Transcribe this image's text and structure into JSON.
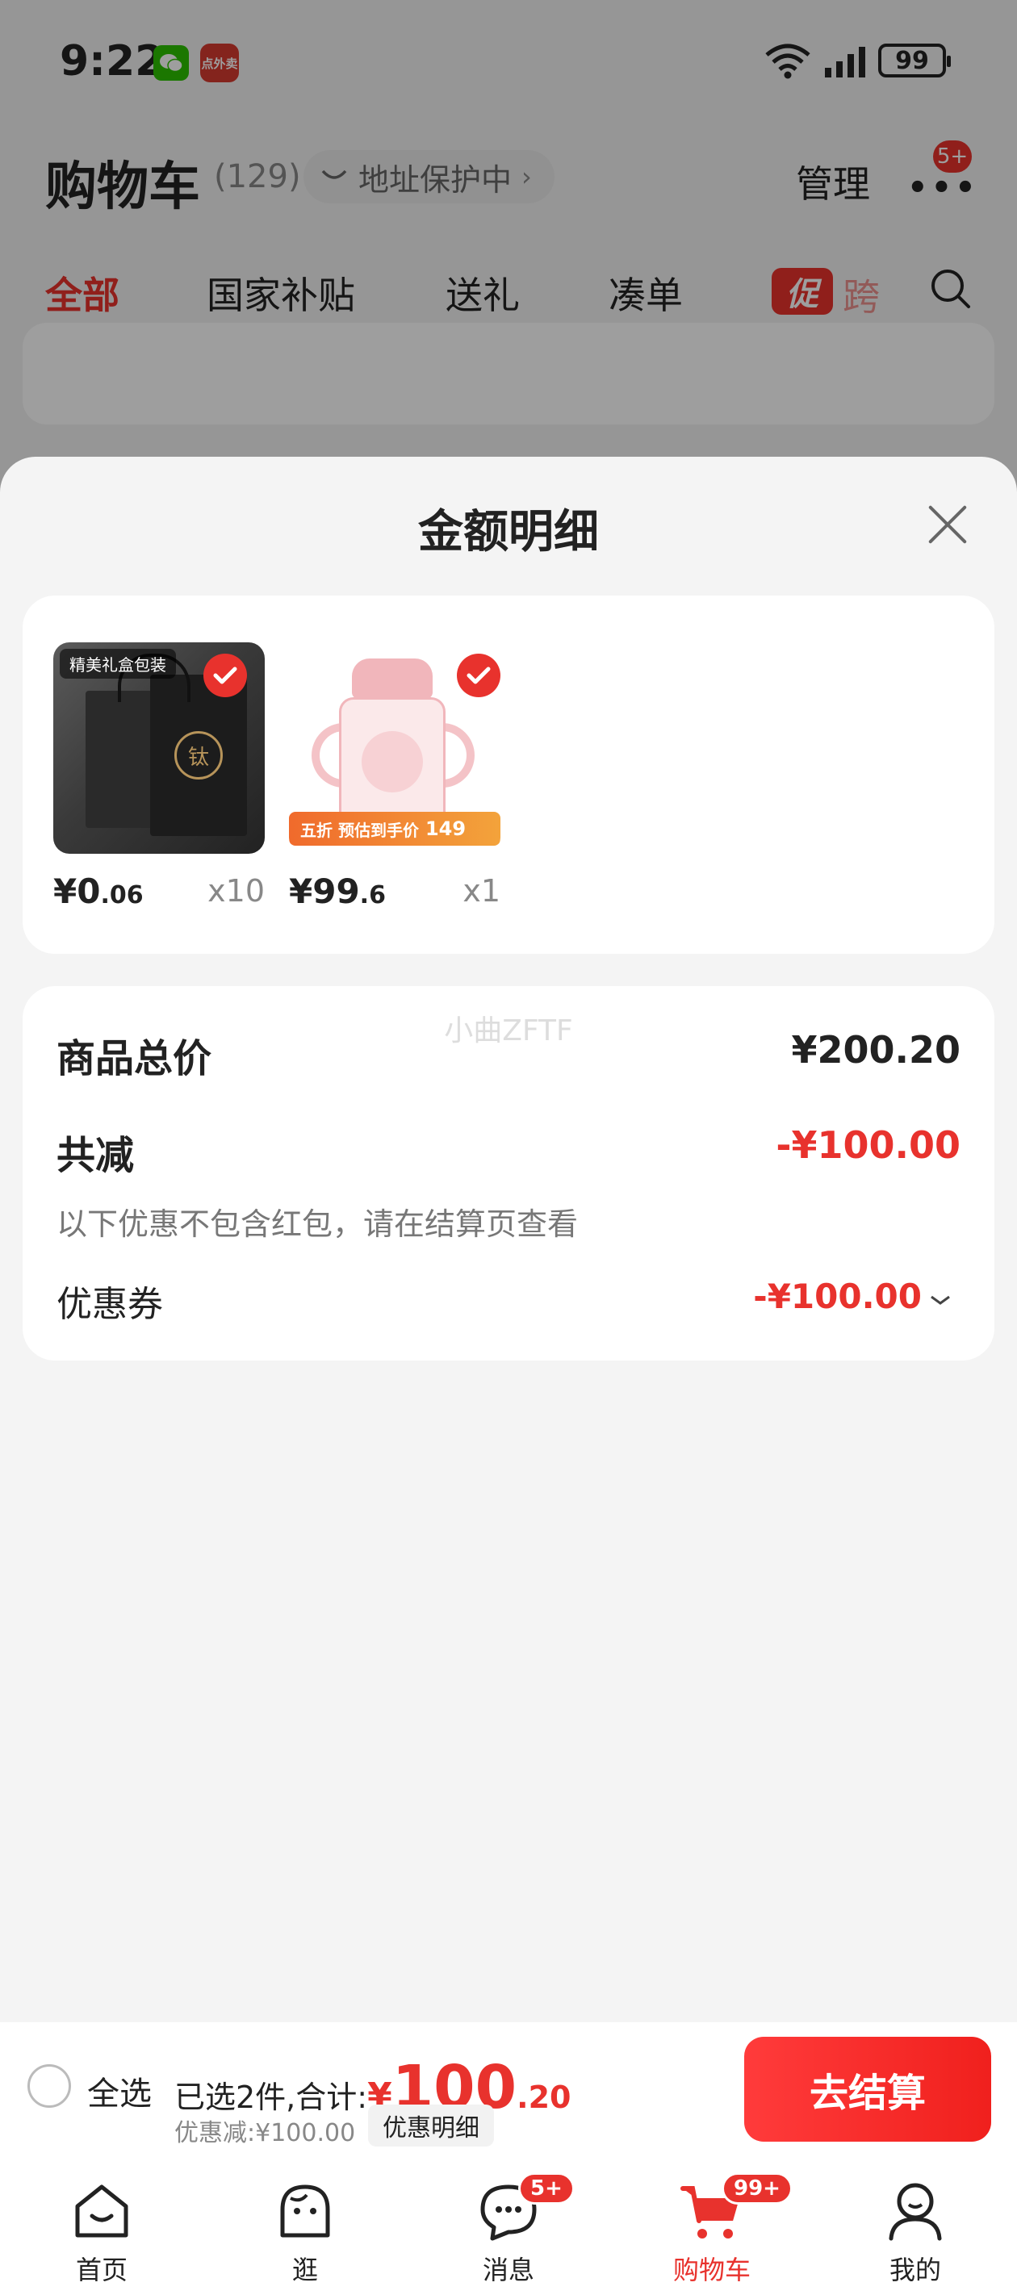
{
  "status_bar": {
    "time": "9:22",
    "battery": "99",
    "app_icon_text": "点外卖"
  },
  "header": {
    "title": "购物车",
    "count": "(129)",
    "address_protect": "地址保护中",
    "manage": "管理",
    "more_badge": "5+"
  },
  "tabs": [
    {
      "label": "全部",
      "active": true
    },
    {
      "label": "国家补贴",
      "active": false
    },
    {
      "label": "送礼",
      "active": false
    },
    {
      "label": "凑单",
      "active": false
    }
  ],
  "promo_tab": {
    "tag": "促",
    "text": "跨"
  },
  "sheet": {
    "title": "金额明细",
    "products": [
      {
        "image_label": "精美礼盒包装",
        "price_int": "¥0",
        "price_dec": ".06",
        "qty": "x10",
        "checked": true
      },
      {
        "sale_text": "五折 预估到手价",
        "sale_price": "149",
        "price_int": "¥99",
        "price_dec": ".6",
        "qty": "x1",
        "checked": true
      }
    ],
    "summary": {
      "total_label": "商品总价",
      "total_value": "¥200.20",
      "reduce_label": "共减",
      "reduce_value": "-¥100.00",
      "note": "以下优惠不包含红包，请在结算页查看",
      "coupon_label": "优惠券",
      "coupon_value": "-¥100.00"
    },
    "watermark": "小曲ZFTF"
  },
  "checkout": {
    "select_all": "全选",
    "selected_text": "已选2件,合计:",
    "total_yen": "¥",
    "total_int": "100",
    "total_dec": ".20",
    "discount_text": "优惠减:¥100.00",
    "detail_button": "优惠明细",
    "checkout_button": "去结算"
  },
  "bottom_nav": [
    {
      "label": "首页",
      "icon": "home-icon",
      "badge": ""
    },
    {
      "label": "逛",
      "icon": "browse-icon",
      "badge": ""
    },
    {
      "label": "消息",
      "icon": "message-icon",
      "badge": "5+"
    },
    {
      "label": "购物车",
      "icon": "cart-icon",
      "badge": "99+",
      "active": true
    },
    {
      "label": "我的",
      "icon": "profile-icon",
      "badge": ""
    }
  ],
  "colors": {
    "accent": "#e8322d",
    "background": "#f4f4f4",
    "card": "#ffffff"
  }
}
